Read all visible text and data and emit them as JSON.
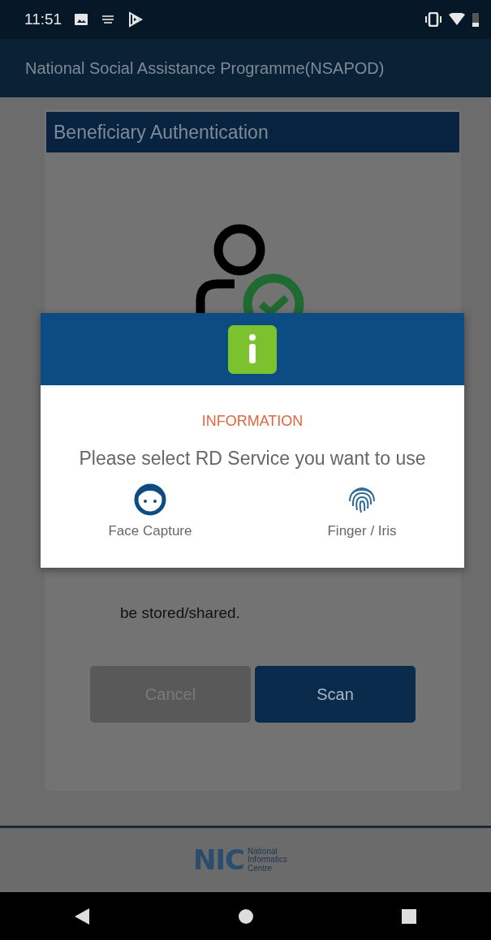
{
  "status_bar": {
    "time": "11:51"
  },
  "app_bar": {
    "title": "National Social Assistance Programme(NSAPOD)"
  },
  "card": {
    "title": "Beneficiary Authentication",
    "text": "be stored/shared.",
    "buttons": [
      {
        "label": "Cancel",
        "kind": "secondary"
      },
      {
        "label": "Scan",
        "kind": "primary"
      }
    ]
  },
  "dialog": {
    "title": "INFORMATION",
    "message": "Please select RD Service you want to use",
    "options": [
      {
        "label": "Face Capture",
        "kind": "face"
      },
      {
        "label": "Finger / Iris",
        "kind": "fingerprint"
      }
    ]
  },
  "footer": {
    "logo_text": "NIC",
    "logo_caption": "National Informatics Centre"
  }
}
